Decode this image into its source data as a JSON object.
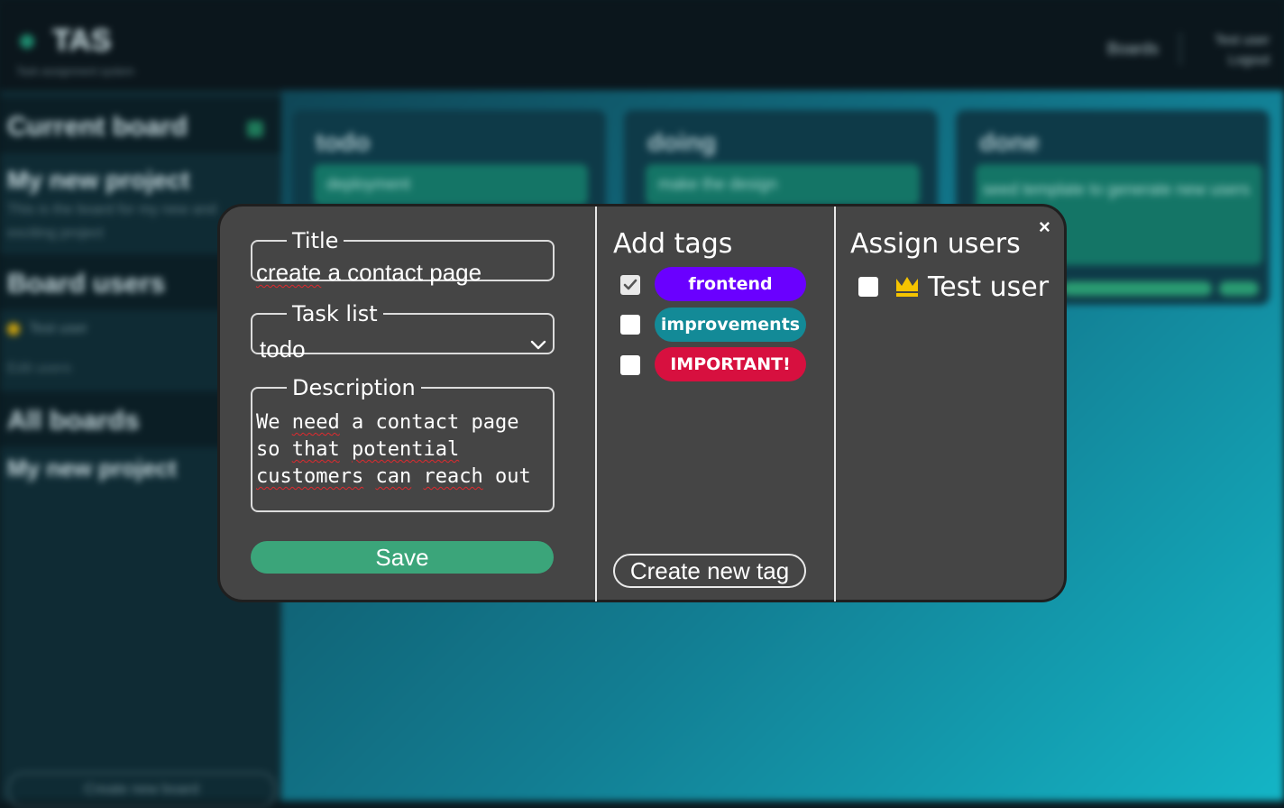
{
  "background": {
    "app_name": "TAS",
    "app_subtitle": "Task assignment system",
    "top_right_link": "Boards",
    "top_right_user": "Test user",
    "top_right_logout": "Logout",
    "sidebar": {
      "current_board_heading": "Current board",
      "project_name": "My new project",
      "project_description": "This is the board for my new and exciting project",
      "board_users_heading": "Board users",
      "board_user": "Test user",
      "edit_users": "Edit users",
      "all_boards_heading": "All boards",
      "all_boards_item": "My new project",
      "create_board": "Create new board"
    },
    "columns": [
      {
        "title": "todo",
        "card": "deployment"
      },
      {
        "title": "doing",
        "card": "make the design"
      },
      {
        "title": "done",
        "card": "seed template to generate new users"
      }
    ]
  },
  "modal": {
    "close_label": "×",
    "title_field": {
      "legend": "Title",
      "value": "create a contact page"
    },
    "tasklist_field": {
      "legend": "Task list",
      "value": "todo"
    },
    "description_field": {
      "legend": "Description",
      "value": "We need a contact page so that potential customers can reach out"
    },
    "save_label": "Save",
    "tags_heading": "Add tags",
    "tags": [
      {
        "label": "frontend",
        "checked": true,
        "color": "#6a00ff",
        "text_color": "#ffffff"
      },
      {
        "label": "improvements",
        "checked": false,
        "color": "#138a97",
        "text_color": "#ffffff"
      },
      {
        "label": "IMPORTANT!",
        "checked": false,
        "color": "#d7103f",
        "text_color": "#ffffff"
      }
    ],
    "create_tag_label": "Create new tag",
    "users_heading": "Assign users",
    "users": [
      {
        "name": "Test user",
        "checked": false,
        "owner": true
      }
    ]
  }
}
